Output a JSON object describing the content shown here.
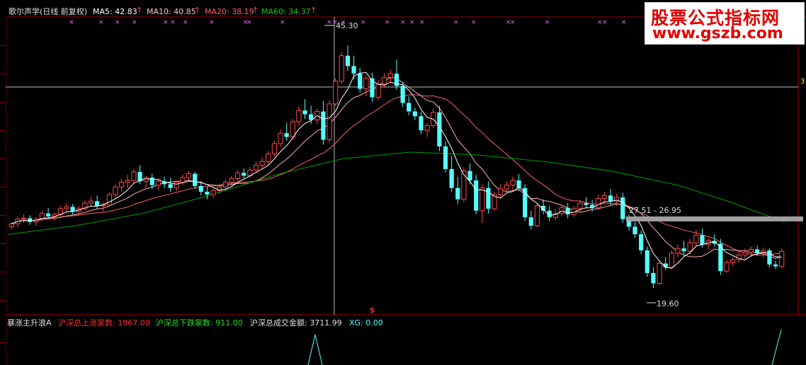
{
  "header": {
    "stock_name": "歌尔声学(日线 前复权)",
    "ma5_label": "MA5: 42.83",
    "ma10_label": "MA10: 40.85",
    "ma20_label": "MA20: 38.19",
    "ma60_label": "MA60: 34.37",
    "arrow_glyph": "↑"
  },
  "watermark": {
    "title": "股票公式指标网",
    "url": "www.gszb.com"
  },
  "annotations": {
    "high_price": "45.30",
    "low_price": "19.60",
    "range_label": "27.51 - 26.95",
    "right_edge_value": "3"
  },
  "indicator": {
    "name": "暴涨主升浪A",
    "up_label": "沪深总上涨家数: 1967.00",
    "down_label": "沪深总下跌家数: 911.00",
    "volume_label": "沪深总成交金额: 3711.99",
    "xg_label": "XG: 0.00",
    "signal_marker": "S"
  },
  "colors": {
    "up": "#ff4a4a",
    "down": "#54ffff",
    "ma5": "#ffffff",
    "ma10": "#ffb0b0",
    "ma20": "#ff6060",
    "ma60": "#00a000",
    "grid_red": "#a00000"
  },
  "chart_data": {
    "type": "candlestick",
    "price_range": [
      17.0,
      48.0
    ],
    "candles": [
      [
        26.1,
        26.6,
        25.8,
        26.4
      ],
      [
        26.4,
        27.2,
        26.0,
        26.9
      ],
      [
        26.9,
        27.4,
        26.5,
        27.0
      ],
      [
        27.0,
        27.3,
        26.3,
        26.6
      ],
      [
        26.6,
        27.1,
        26.2,
        26.9
      ],
      [
        26.9,
        27.8,
        26.7,
        27.5
      ],
      [
        27.5,
        28.1,
        27.0,
        27.2
      ],
      [
        27.2,
        27.6,
        26.7,
        27.4
      ],
      [
        27.4,
        28.3,
        27.1,
        28.0
      ],
      [
        28.0,
        28.6,
        27.6,
        28.2
      ],
      [
        28.2,
        28.5,
        27.4,
        27.7
      ],
      [
        27.7,
        28.3,
        27.3,
        28.0
      ],
      [
        28.0,
        28.9,
        27.8,
        28.6
      ],
      [
        28.6,
        29.3,
        28.2,
        28.8
      ],
      [
        28.8,
        29.4,
        28.0,
        28.3
      ],
      [
        28.3,
        28.7,
        27.7,
        28.4
      ],
      [
        28.4,
        29.7,
        28.2,
        29.5
      ],
      [
        29.5,
        30.6,
        29.1,
        30.3
      ],
      [
        30.3,
        31.2,
        29.8,
        30.8
      ],
      [
        30.8,
        31.6,
        30.2,
        31.0
      ],
      [
        31.0,
        32.2,
        30.7,
        31.9
      ],
      [
        31.9,
        32.6,
        30.6,
        30.9
      ],
      [
        30.9,
        31.5,
        30.2,
        31.3
      ],
      [
        31.3,
        31.7,
        30.1,
        30.5
      ],
      [
        30.5,
        31.2,
        30.0,
        30.9
      ],
      [
        30.9,
        31.4,
        30.2,
        30.6
      ],
      [
        30.6,
        31.3,
        29.8,
        30.2
      ],
      [
        30.2,
        31.0,
        29.9,
        30.8
      ],
      [
        30.8,
        31.6,
        30.5,
        31.3
      ],
      [
        31.3,
        32.0,
        30.9,
        31.7
      ],
      [
        31.7,
        31.9,
        30.1,
        30.4
      ],
      [
        30.4,
        30.9,
        29.4,
        29.8
      ],
      [
        29.8,
        30.3,
        29.0,
        29.5
      ],
      [
        29.5,
        30.2,
        29.1,
        29.9
      ],
      [
        29.9,
        30.6,
        29.6,
        30.3
      ],
      [
        30.3,
        31.1,
        30.0,
        30.8
      ],
      [
        30.8,
        31.5,
        30.4,
        31.2
      ],
      [
        31.2,
        32.1,
        30.9,
        31.8
      ],
      [
        31.8,
        32.3,
        31.2,
        31.5
      ],
      [
        31.5,
        32.4,
        31.3,
        32.1
      ],
      [
        32.1,
        33.0,
        31.8,
        32.6
      ],
      [
        32.6,
        33.4,
        32.2,
        33.0
      ],
      [
        33.0,
        34.1,
        32.7,
        33.8
      ],
      [
        33.8,
        35.2,
        33.5,
        34.9
      ],
      [
        34.9,
        36.4,
        34.5,
        36.0
      ],
      [
        36.0,
        37.1,
        35.2,
        35.6
      ],
      [
        35.6,
        37.5,
        35.3,
        37.2
      ],
      [
        37.2,
        38.8,
        36.8,
        38.4
      ],
      [
        38.4,
        39.6,
        37.5,
        38.0
      ],
      [
        38.0,
        38.9,
        37.0,
        37.4
      ],
      [
        37.4,
        38.6,
        37.0,
        38.3
      ],
      [
        38.3,
        39.4,
        34.8,
        35.3
      ],
      [
        35.3,
        39.5,
        35.0,
        39.1
      ],
      [
        39.1,
        41.8,
        38.9,
        41.5
      ],
      [
        41.5,
        44.6,
        41.2,
        44.2
      ],
      [
        44.2,
        45.3,
        42.6,
        43.1
      ],
      [
        43.1,
        44.2,
        41.7,
        42.3
      ],
      [
        42.3,
        42.9,
        40.3,
        40.7
      ],
      [
        40.7,
        42.1,
        39.9,
        41.8
      ],
      [
        41.8,
        42.4,
        39.3,
        39.8
      ],
      [
        39.8,
        41.6,
        39.5,
        41.2
      ],
      [
        41.2,
        42.3,
        40.8,
        41.9
      ],
      [
        41.9,
        42.7,
        41.3,
        42.3
      ],
      [
        42.3,
        43.8,
        40.6,
        41.0
      ],
      [
        41.0,
        41.4,
        38.8,
        39.2
      ],
      [
        39.2,
        39.9,
        37.9,
        38.3
      ],
      [
        38.3,
        38.7,
        37.4,
        37.8
      ],
      [
        37.8,
        38.3,
        35.9,
        36.3
      ],
      [
        36.3,
        37.1,
        35.6,
        36.8
      ],
      [
        36.8,
        38.6,
        36.5,
        38.2
      ],
      [
        38.2,
        38.9,
        34.1,
        34.6
      ],
      [
        34.6,
        35.1,
        31.8,
        32.2
      ],
      [
        32.2,
        33.6,
        29.8,
        30.2
      ],
      [
        30.2,
        31.4,
        28.5,
        29.0
      ],
      [
        29.0,
        32.4,
        28.7,
        32.0
      ],
      [
        32.0,
        32.8,
        30.6,
        31.0
      ],
      [
        31.0,
        31.6,
        27.4,
        27.8
      ],
      [
        27.8,
        30.6,
        26.5,
        30.2
      ],
      [
        30.2,
        30.9,
        27.5,
        28.0
      ],
      [
        28.0,
        29.8,
        27.8,
        29.5
      ],
      [
        29.5,
        30.6,
        29.1,
        30.1
      ],
      [
        30.1,
        30.9,
        29.6,
        30.5
      ],
      [
        30.5,
        31.4,
        29.9,
        31.0
      ],
      [
        31.0,
        31.7,
        29.9,
        30.2
      ],
      [
        30.2,
        30.6,
        26.7,
        27.1
      ],
      [
        27.1,
        27.8,
        25.8,
        26.2
      ],
      [
        26.2,
        28.6,
        26.0,
        28.3
      ],
      [
        28.3,
        29.0,
        27.4,
        27.8
      ],
      [
        27.8,
        28.3,
        26.7,
        27.1
      ],
      [
        27.1,
        27.9,
        26.8,
        27.5
      ],
      [
        27.5,
        28.4,
        27.2,
        28.1
      ],
      [
        28.1,
        28.6,
        27.0,
        27.4
      ],
      [
        27.4,
        28.3,
        27.1,
        28.0
      ],
      [
        28.0,
        28.9,
        27.6,
        28.6
      ],
      [
        28.6,
        29.2,
        28.1,
        28.4
      ],
      [
        28.4,
        28.9,
        27.7,
        28.1
      ],
      [
        28.1,
        29.5,
        27.9,
        29.1
      ],
      [
        29.1,
        29.8,
        28.6,
        29.4
      ],
      [
        29.4,
        30.1,
        28.4,
        28.8
      ],
      [
        28.8,
        29.6,
        28.3,
        29.2
      ],
      [
        29.2,
        29.7,
        26.5,
        26.9
      ],
      [
        26.9,
        27.4,
        25.7,
        26.1
      ],
      [
        26.1,
        26.6,
        24.9,
        25.3
      ],
      [
        25.3,
        25.7,
        23.2,
        23.6
      ],
      [
        23.6,
        24.0,
        20.8,
        21.2
      ],
      [
        21.2,
        21.8,
        19.6,
        20.1
      ],
      [
        20.1,
        22.6,
        19.9,
        22.2
      ],
      [
        22.2,
        22.9,
        21.5,
        21.8
      ],
      [
        21.8,
        23.6,
        21.6,
        23.3
      ],
      [
        23.3,
        24.2,
        22.9,
        23.8
      ],
      [
        23.8,
        24.6,
        23.1,
        23.5
      ],
      [
        23.5,
        24.8,
        23.2,
        24.4
      ],
      [
        24.4,
        25.8,
        24.0,
        25.2
      ],
      [
        25.2,
        25.9,
        23.9,
        24.2
      ],
      [
        24.2,
        24.9,
        23.7,
        24.6
      ],
      [
        24.6,
        25.3,
        24.0,
        24.3
      ],
      [
        24.3,
        24.8,
        21.0,
        21.4
      ],
      [
        21.4,
        22.6,
        21.2,
        22.3
      ],
      [
        22.3,
        22.9,
        21.9,
        22.6
      ],
      [
        22.6,
        23.4,
        22.3,
        23.1
      ],
      [
        23.1,
        23.8,
        22.7,
        23.4
      ],
      [
        23.4,
        24.0,
        22.9,
        23.7
      ],
      [
        23.7,
        24.1,
        23.0,
        23.3
      ],
      [
        23.3,
        23.9,
        22.8,
        23.6
      ],
      [
        23.6,
        23.8,
        21.8,
        22.1
      ],
      [
        22.1,
        22.5,
        21.6,
        21.9
      ],
      [
        21.9,
        23.8,
        21.7,
        23.5
      ]
    ],
    "ma60": [
      [
        0,
        25.3
      ],
      [
        20,
        26.2
      ],
      [
        40,
        27.5
      ],
      [
        60,
        29.4
      ],
      [
        80,
        31.6
      ],
      [
        100,
        33.3
      ],
      [
        120,
        34.0
      ],
      [
        140,
        33.7
      ],
      [
        160,
        33.0
      ],
      [
        180,
        32.0
      ],
      [
        200,
        30.5
      ],
      [
        215,
        28.8
      ],
      [
        232,
        26.6
      ]
    ],
    "indicator_signal_indices": [
      88,
      224
    ]
  }
}
